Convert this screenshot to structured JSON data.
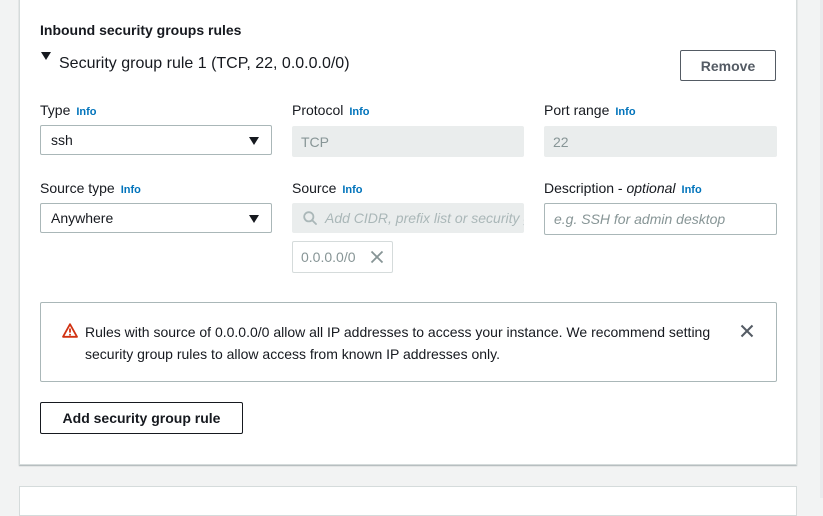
{
  "section": {
    "title": "Inbound security groups rules"
  },
  "rule": {
    "title": "Security group rule 1 (TCP, 22, 0.0.0.0/0)",
    "remove_label": "Remove"
  },
  "fields": {
    "type": {
      "label": "Type",
      "info": "Info",
      "value": "ssh"
    },
    "protocol": {
      "label": "Protocol",
      "info": "Info",
      "value": "TCP"
    },
    "port_range": {
      "label": "Port range",
      "info": "Info",
      "value": "22"
    },
    "source_type": {
      "label": "Source type",
      "info": "Info",
      "value": "Anywhere"
    },
    "source": {
      "label": "Source",
      "info": "Info",
      "placeholder": "Add CIDR, prefix list or security group",
      "tokens": [
        "0.0.0.0/0"
      ]
    },
    "description": {
      "label": "Description",
      "optional": "optional",
      "separator": " - ",
      "info": "Info",
      "placeholder": "e.g. SSH for admin desktop"
    }
  },
  "alert": {
    "message": "Rules with source of 0.0.0.0/0 allow all IP addresses to access your instance. We recommend setting security group rules to allow access from known IP addresses only."
  },
  "add_rule_label": "Add security group rule",
  "colors": {
    "info_link": "#0073bb",
    "warning": "#d13212",
    "readonly_bg": "#eaeded",
    "border": "#aab7b8"
  },
  "icons": {
    "expand": "caret-down-icon",
    "search": "search-icon",
    "token_remove": "close-icon",
    "warning": "warning-triangle-icon",
    "dismiss": "close-icon"
  }
}
